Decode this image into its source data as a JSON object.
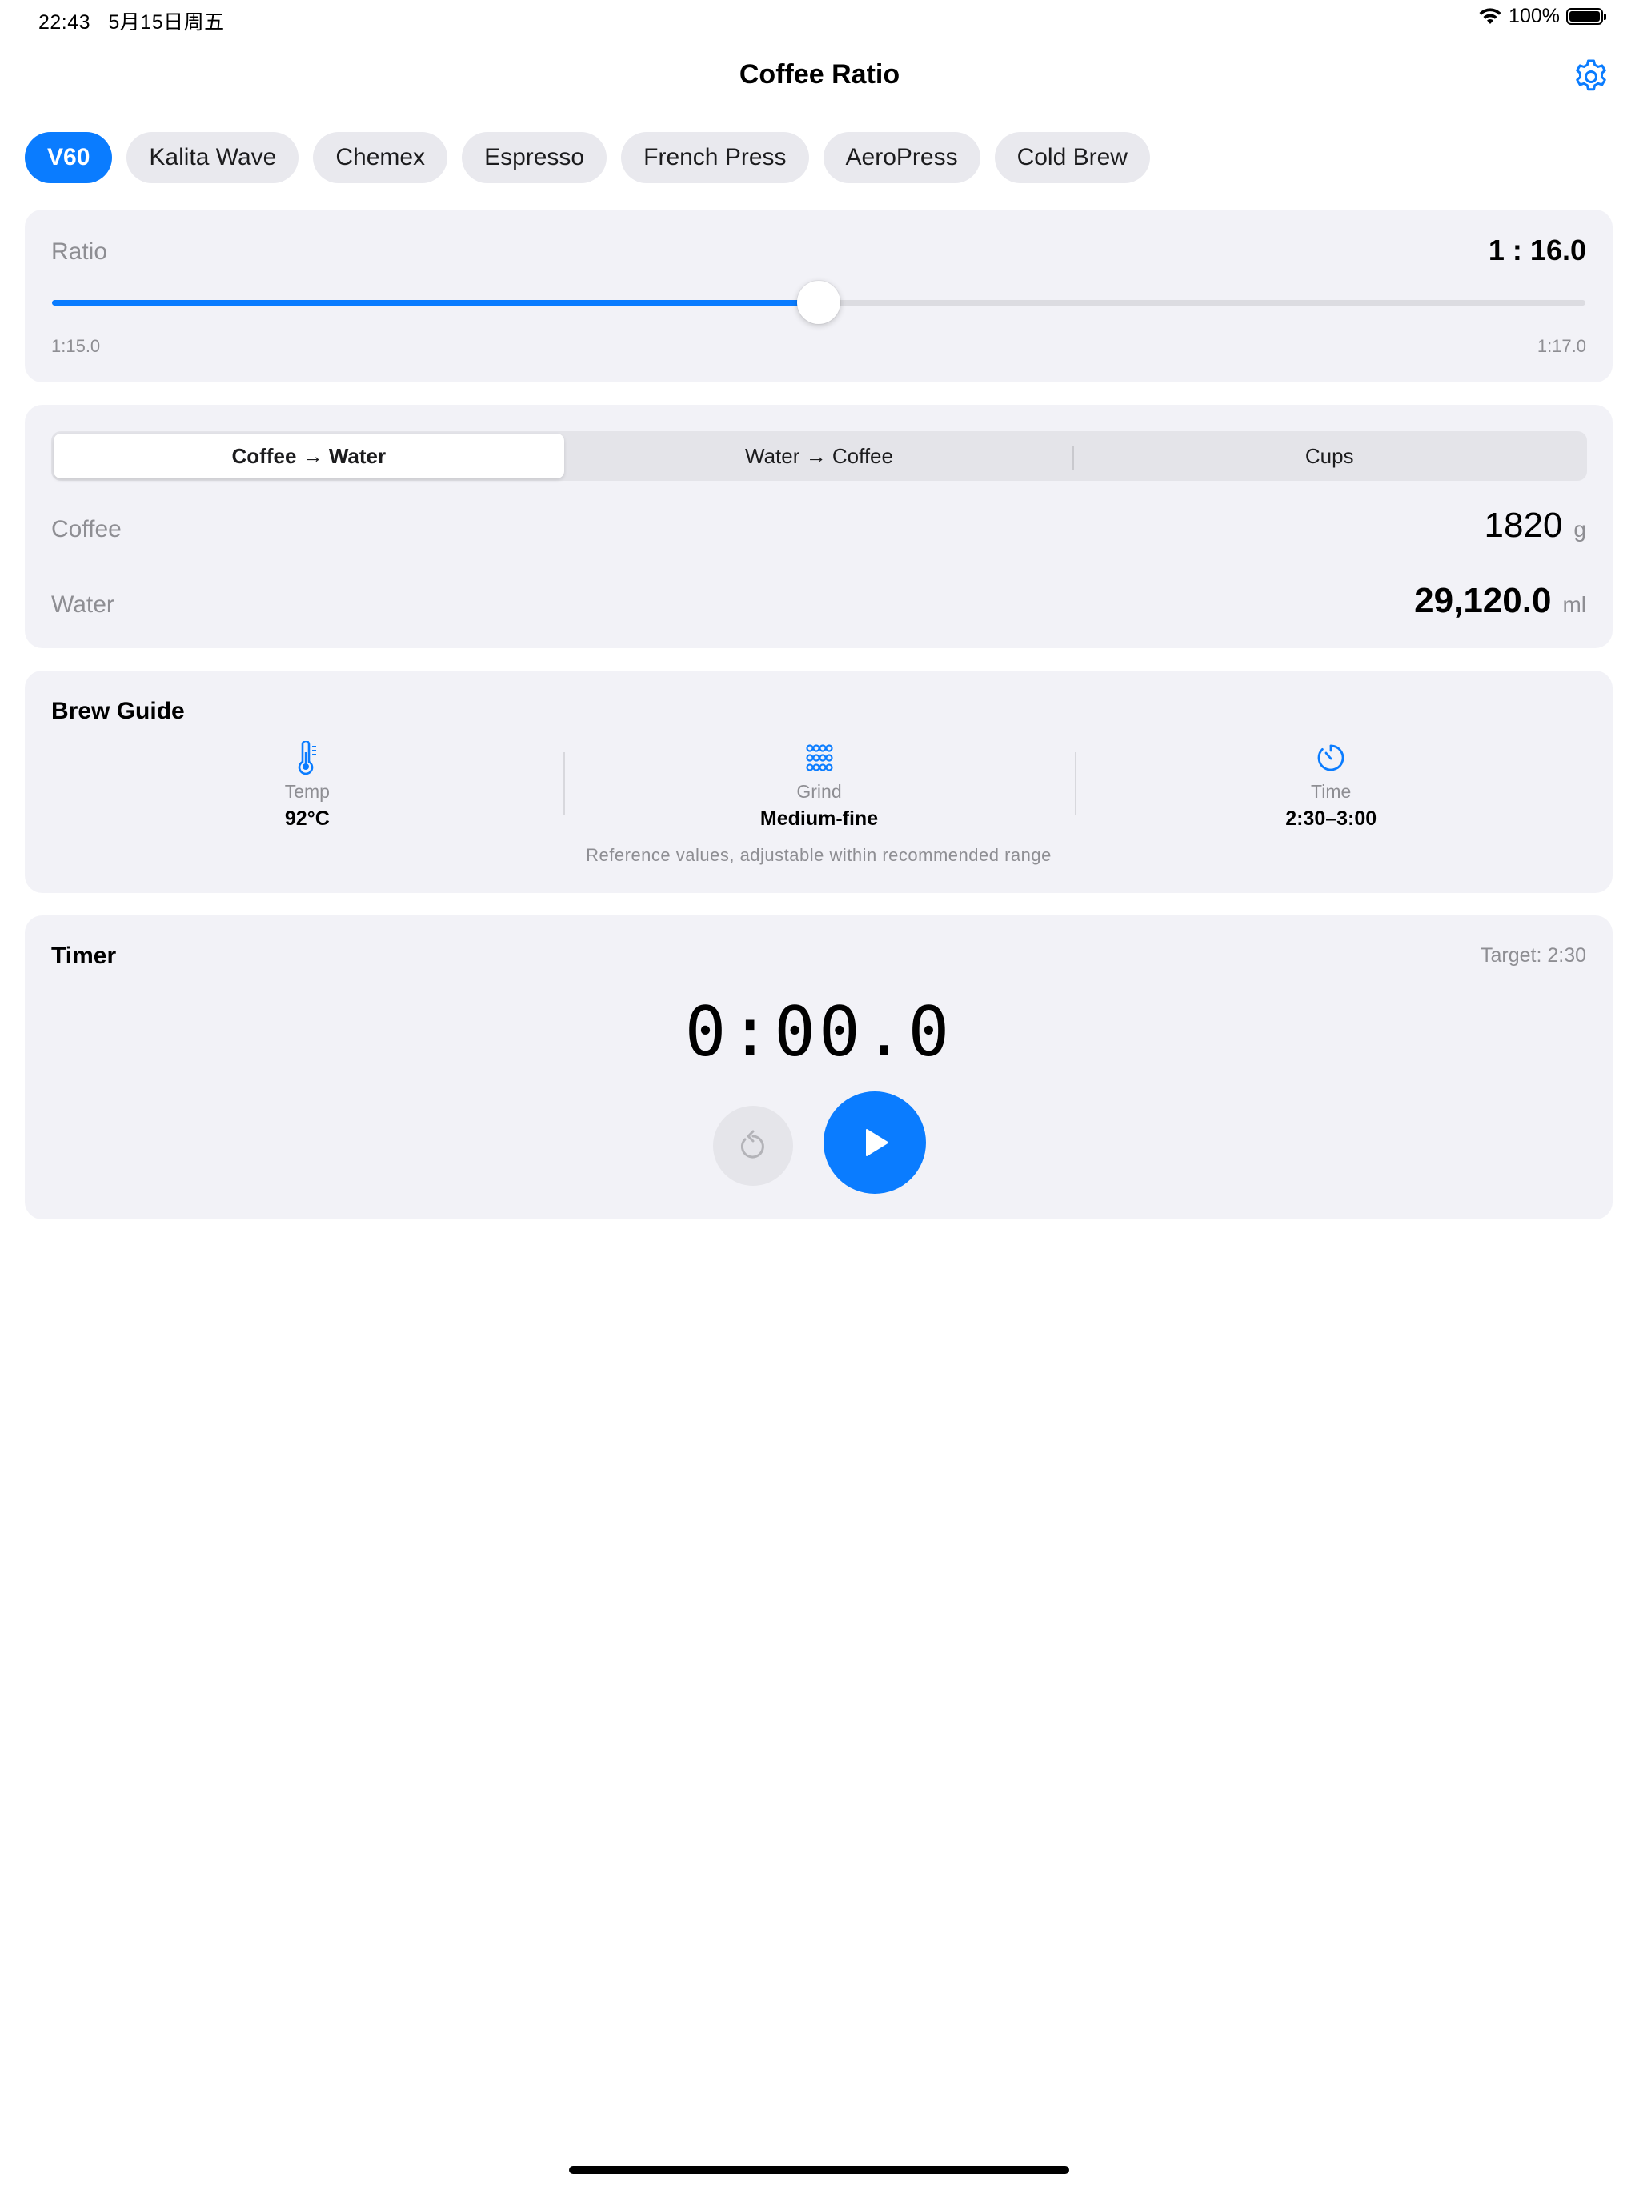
{
  "status_bar": {
    "time": "22:43",
    "date": "5月15日周五",
    "battery": "100%"
  },
  "nav": {
    "title": "Coffee Ratio"
  },
  "methods": [
    {
      "label": "V60",
      "active": true
    },
    {
      "label": "Kalita Wave",
      "active": false
    },
    {
      "label": "Chemex",
      "active": false
    },
    {
      "label": "Espresso",
      "active": false
    },
    {
      "label": "French Press",
      "active": false
    },
    {
      "label": "AeroPress",
      "active": false
    },
    {
      "label": "Cold Brew",
      "active": false
    }
  ],
  "ratio": {
    "label": "Ratio",
    "value_text": "1 : 16.0",
    "min_label": "1:15.0",
    "max_label": "1:17.0",
    "min": 15.0,
    "max": 17.0,
    "value": 16.0
  },
  "converter": {
    "modes": [
      "Coffee → Water",
      "Water → Coffee",
      "Cups"
    ],
    "active_mode": 0,
    "coffee": {
      "label": "Coffee",
      "value": "1820",
      "unit": "g"
    },
    "water": {
      "label": "Water",
      "value": "29,120.0",
      "unit": "ml"
    }
  },
  "brew_guide": {
    "title": "Brew Guide",
    "items": [
      {
        "icon": "thermometer-icon",
        "label": "Temp",
        "value": "92°C"
      },
      {
        "icon": "grind-grid-icon",
        "label": "Grind",
        "value": "Medium-fine"
      },
      {
        "icon": "timer-icon",
        "label": "Time",
        "value": "2:30–3:00"
      }
    ],
    "note": "Reference values, adjustable within recommended range"
  },
  "timer": {
    "title": "Timer",
    "target": "Target: 2:30",
    "display": "0:00.0"
  },
  "colors": {
    "accent": "#0a7cff",
    "card_bg": "#f2f2f7",
    "chip_bg": "#e9e9ee",
    "secondary_text": "#8e8e93"
  }
}
